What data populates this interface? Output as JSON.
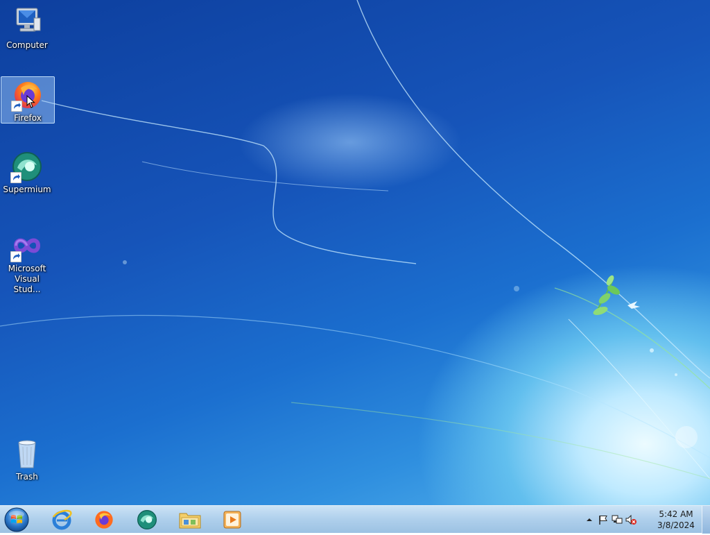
{
  "desktop": {
    "icons": [
      {
        "label": "Computer",
        "icon": "computer-icon"
      },
      {
        "label": "Firefox",
        "icon": "firefox-icon",
        "selected": true
      },
      {
        "label": "Supermium",
        "icon": "supermium-icon"
      },
      {
        "label": "Microsoft\nVisual Stud...",
        "icon": "visual-studio-icon"
      },
      {
        "label": "Trash",
        "icon": "recycle-bin-icon"
      }
    ]
  },
  "taskbar": {
    "start_icon": "windows-orb-icon",
    "pinned": [
      "internet-explorer-icon",
      "firefox-icon",
      "supermium-icon",
      "file-explorer-icon",
      "media-player-icon"
    ],
    "tray": {
      "icons": [
        "show-hidden-icons-chevron",
        "action-center-flag-icon",
        "network-icon",
        "volume-muted-icon"
      ],
      "time": "5:42 AM",
      "date": "3/8/2024"
    }
  },
  "colors": {
    "taskbar": "#b4d2ee",
    "selection": "#a9d0ff"
  }
}
